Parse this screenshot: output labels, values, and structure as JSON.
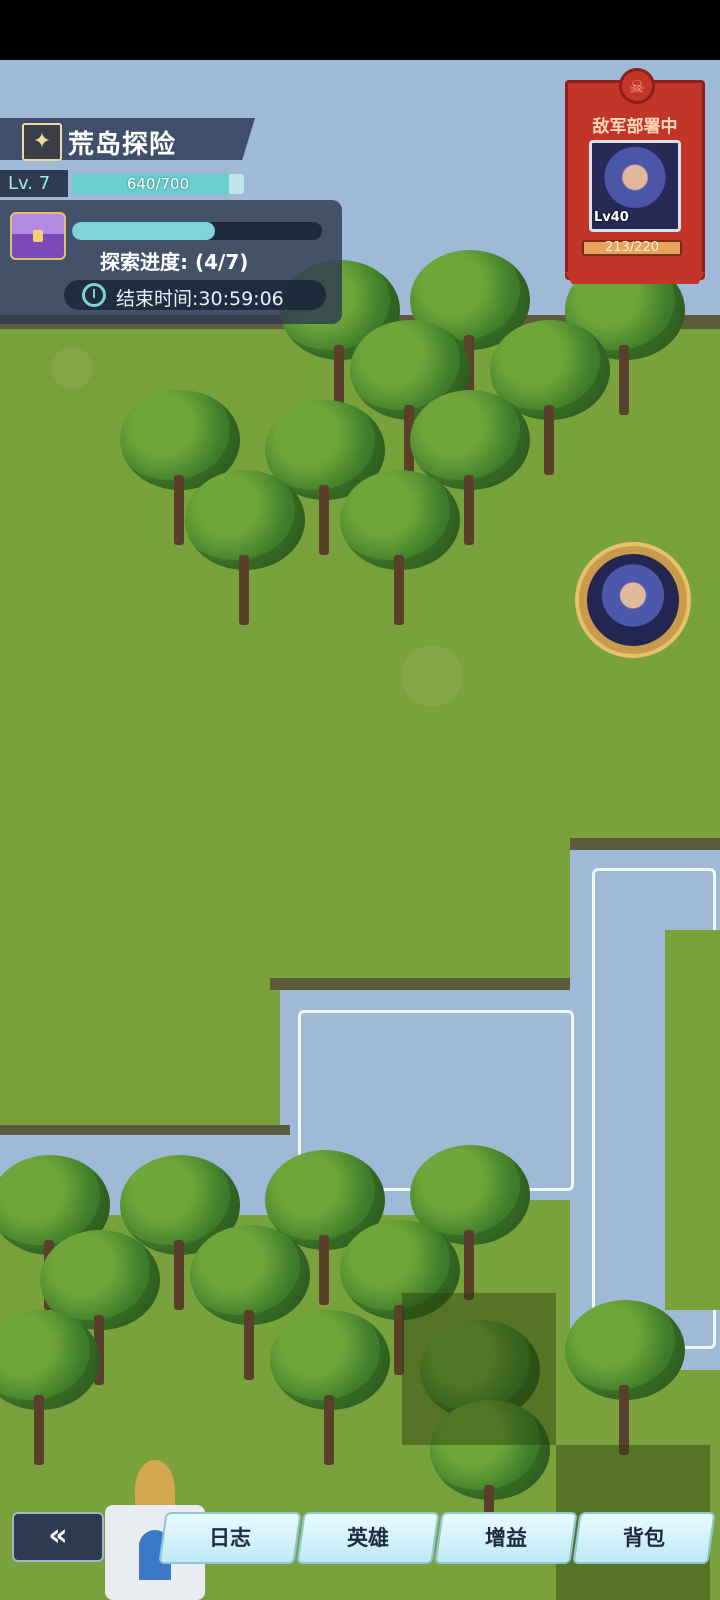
{
  "title": "荒岛探险",
  "level": {
    "label": "Lv. 7",
    "current": 640,
    "max": 700,
    "text": "640/700"
  },
  "explore": {
    "progress_text": "探索进度: (4/7)",
    "progress": 0.57,
    "end_time_label": "结束时间:",
    "end_time": "30:59:06"
  },
  "enemy": {
    "title": "敌军部署中",
    "level": "Lv40",
    "hp_text": "213/220",
    "hp": 213,
    "hp_max": 220
  },
  "nav": {
    "back": "«",
    "log": "日志",
    "heroes": "英雄",
    "buffs": "增益",
    "bag": "背包"
  },
  "icons": [
    "box-icon",
    "treasure-chest-icon",
    "clock-icon",
    "skull-icon",
    "hero-portrait",
    "castle-icon"
  ]
}
